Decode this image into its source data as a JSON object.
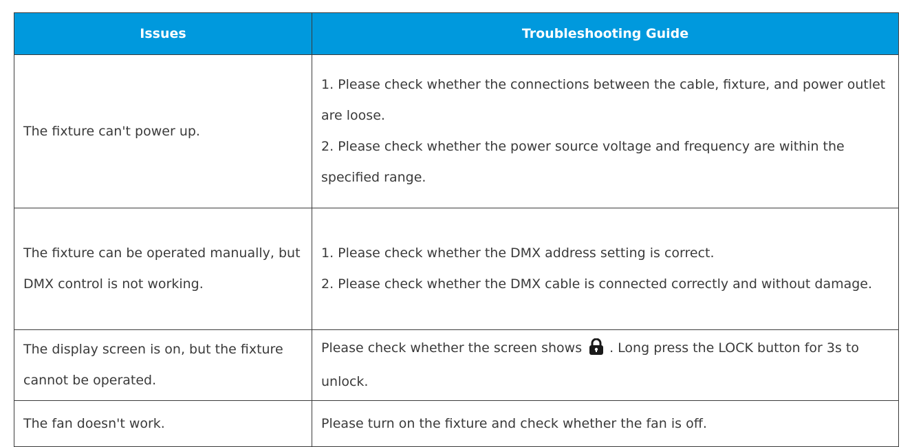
{
  "header": {
    "issues": "Issues",
    "guide": "Troubleshooting Guide"
  },
  "rows": [
    {
      "issue": "The fixture can't power up.",
      "steps": [
        "1. Please check whether the connections between the cable, fixture, and power outlet are loose.",
        "2. Please check whether the power source voltage and frequency are within the specified range."
      ]
    },
    {
      "issue": "The fixture can be operated manually, but DMX control is not working.",
      "steps": [
        "1. Please check whether the DMX address setting is correct.",
        "2. Please check whether the DMX cable is connected correctly and without damage."
      ]
    },
    {
      "issue": "The display screen is on, but the fixture cannot be operated.",
      "guide_before_icon": "Please check whether the screen shows",
      "guide_after_icon": ". Long press the LOCK button for 3s to unlock.",
      "icon": "lock-icon"
    },
    {
      "issue": "The fan doesn't work.",
      "guide": "Please turn on the fixture and check whether the fan is off."
    }
  ],
  "colors": {
    "header_bg": "#0099dd",
    "header_text": "#ffffff",
    "body_text": "#3a3a3a",
    "border": "#3a3a3a"
  }
}
